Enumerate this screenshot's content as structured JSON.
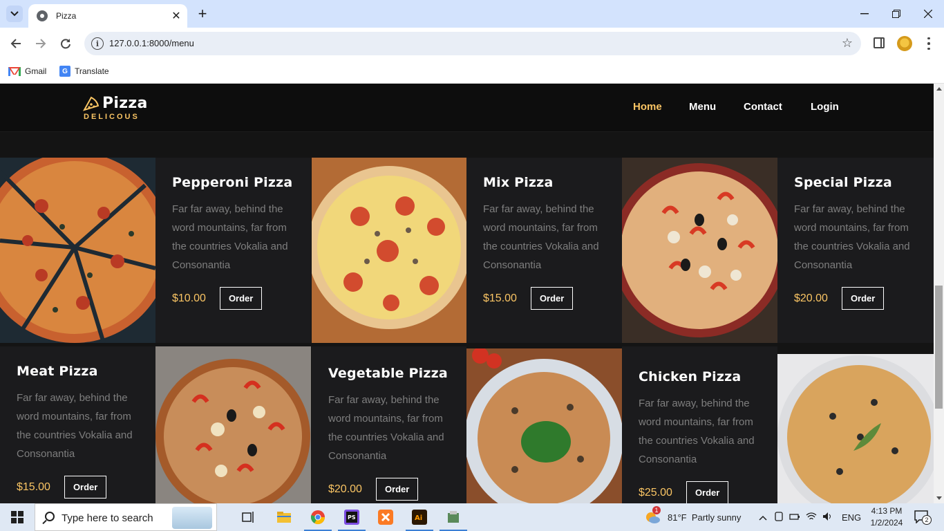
{
  "browser": {
    "tab_title": "Pizza",
    "url": "127.0.0.1:8000/menu",
    "bookmarks": [
      {
        "label": "Gmail",
        "icon": "gmail-icon"
      },
      {
        "label": "Translate",
        "icon": "translate-icon"
      }
    ]
  },
  "site": {
    "logo_name": "Pizza",
    "logo_tagline": "DELICOUS",
    "nav": [
      {
        "label": "Home",
        "active": true
      },
      {
        "label": "Menu",
        "active": false
      },
      {
        "label": "Contact",
        "active": false
      },
      {
        "label": "Login",
        "active": false
      }
    ],
    "order_label": "Order",
    "accent_color": "#fac564",
    "items": [
      {
        "name": "Pepperoni Pizza",
        "description": "Far far away, behind the word mountains, far from the countries Vokalia and Consonantia",
        "price": "$10.00"
      },
      {
        "name": "Mix Pizza",
        "description": "Far far away, behind the word mountains, far from the countries Vokalia and Consonantia",
        "price": "$15.00"
      },
      {
        "name": "Special Pizza",
        "description": "Far far away, behind the word mountains, far from the countries Vokalia and Consonantia",
        "price": "$20.00"
      },
      {
        "name": "Meat Pizza",
        "description": "Far far away, behind the word mountains, far from the countries Vokalia and Consonantia",
        "price": "$15.00"
      },
      {
        "name": "Vegetable Pizza",
        "description": "Far far away, behind the word mountains, far from the countries Vokalia and Consonantia",
        "price": "$20.00"
      },
      {
        "name": "Chicken Pizza",
        "description": "Far far away, behind the word mountains, far from the countries Vokalia and Consonantia",
        "price": "$25.00"
      }
    ]
  },
  "taskbar": {
    "search_placeholder": "Type here to search",
    "weather": "81°F  Partly sunny",
    "weather_badge": "1",
    "language": "ENG",
    "time": "4:13 PM",
    "date": "1/2/2024",
    "notifications": "2"
  }
}
